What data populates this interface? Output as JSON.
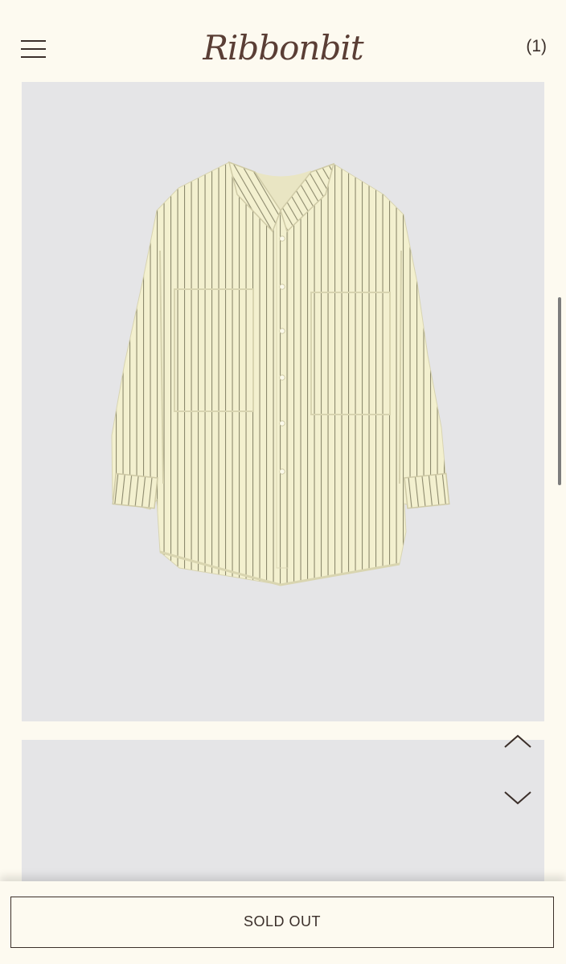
{
  "header": {
    "logo_text": "Ribbonbit",
    "cart_count": "(1)",
    "menu_icon": "hamburger-icon"
  },
  "product": {
    "image_desc_icon": "striped-shirt-image",
    "shirt_color": "#f3f0cf",
    "stripe_color": "#8d8a6e",
    "background_color": "#e5e5e7"
  },
  "gallery": {
    "up_icon": "chevron-up-icon",
    "down_icon": "chevron-down-icon"
  },
  "actions": {
    "sold_out_label": "SOLD OUT"
  },
  "colors": {
    "page_background": "#fdfaf0",
    "text": "#3b2f2a",
    "logo": "#5a3e35"
  }
}
